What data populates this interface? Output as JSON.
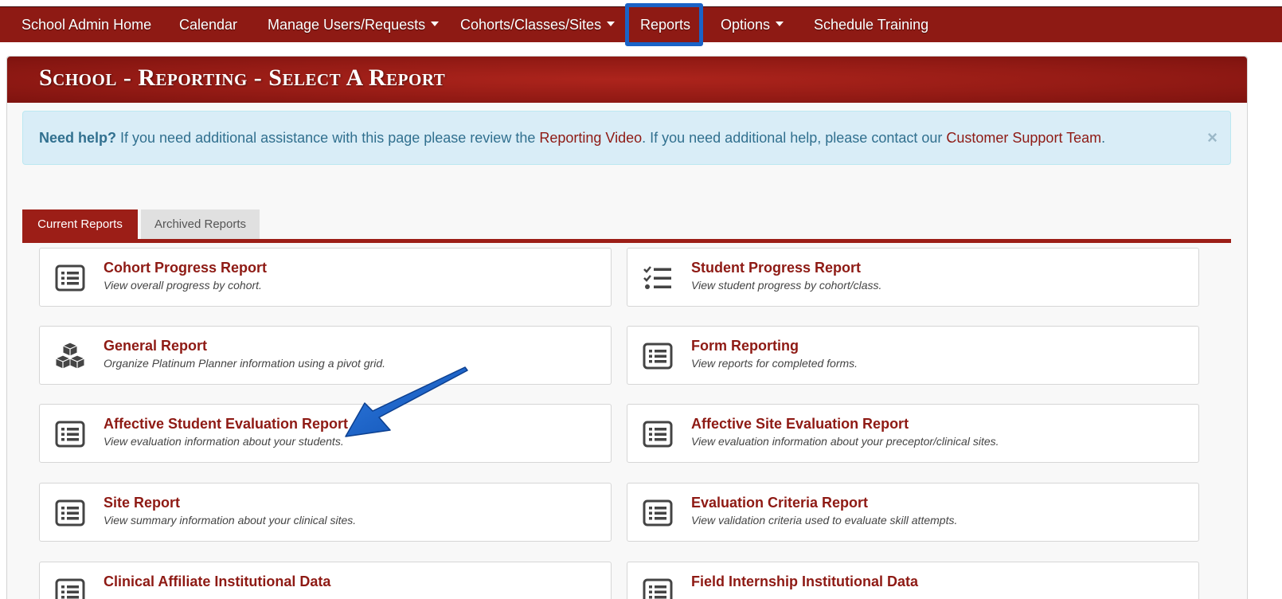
{
  "nav": {
    "items": [
      {
        "label": "School Admin Home",
        "dropdown": false
      },
      {
        "label": "Calendar",
        "dropdown": false
      },
      {
        "label": "Manage Users/Requests",
        "dropdown": true
      },
      {
        "label": "Cohorts/Classes/Sites",
        "dropdown": true
      },
      {
        "label": "Reports",
        "dropdown": false
      },
      {
        "label": "Options",
        "dropdown": true
      },
      {
        "label": "Schedule Training",
        "dropdown": false
      }
    ],
    "active_item": "Reports"
  },
  "page": {
    "title": "School - Reporting - Select A Report"
  },
  "alert": {
    "bold": "Need help?",
    "text1": " If you need additional assistance with this page please review the ",
    "link1": "Reporting Video",
    "text2": ". If you need additional help, please contact our ",
    "link2": "Customer Support Team",
    "text3": ".",
    "close": "×"
  },
  "tabs": [
    {
      "label": "Current Reports",
      "active": true
    },
    {
      "label": "Archived Reports",
      "active": false
    }
  ],
  "reports": [
    {
      "title": "Cohort Progress Report",
      "desc": "View overall progress by cohort.",
      "icon": "list-alt-icon"
    },
    {
      "title": "Student Progress Report",
      "desc": "View student progress by cohort/class.",
      "icon": "tasks-icon"
    },
    {
      "title": "General Report",
      "desc": "Organize Platinum Planner information using a pivot grid.",
      "icon": "cubes-icon"
    },
    {
      "title": "Form Reporting",
      "desc": "View reports for completed forms.",
      "icon": "list-alt-icon"
    },
    {
      "title": "Affective Student Evaluation Report",
      "desc": "View evaluation information about your students.",
      "icon": "list-alt-icon"
    },
    {
      "title": "Affective Site Evaluation Report",
      "desc": "View evaluation information about your preceptor/clinical sites.",
      "icon": "list-alt-icon"
    },
    {
      "title": "Site Report",
      "desc": "View summary information about your clinical sites.",
      "icon": "list-alt-icon"
    },
    {
      "title": "Evaluation Criteria Report",
      "desc": "View validation criteria used to evaluate skill attempts.",
      "icon": "list-alt-icon"
    },
    {
      "title": "Clinical Affiliate Institutional Data",
      "desc": "",
      "icon": "list-alt-icon"
    },
    {
      "title": "Field Internship Institutional Data",
      "desc": "",
      "icon": "list-alt-icon"
    }
  ],
  "colors": {
    "brand": "#8e1a14",
    "highlight": "#1a63c7",
    "alert_bg": "#d9edf7",
    "alert_text": "#31708f"
  }
}
